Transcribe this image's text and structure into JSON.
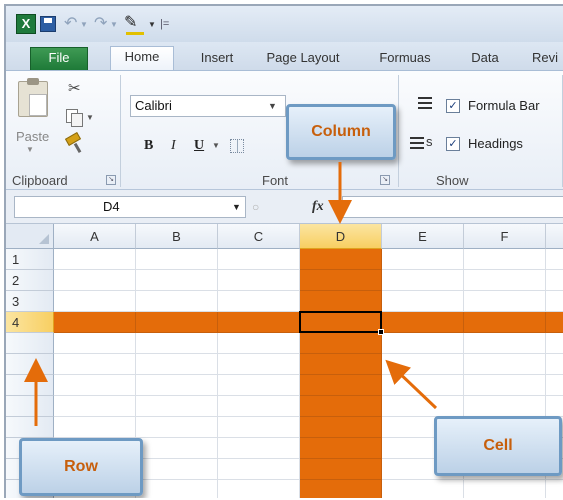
{
  "quick_access": {
    "logo_text": "X",
    "more_glyph": "|="
  },
  "tabs": {
    "file": "File",
    "home": "Home",
    "insert": "Insert",
    "page_layout": "Page Layout",
    "formulas": "Formuas",
    "data": "Data",
    "review": "Revi"
  },
  "ribbon": {
    "clipboard": {
      "paste_label": "Paste",
      "group_label": "Clipboard"
    },
    "font": {
      "font_name": "Calibri",
      "bold": "B",
      "italic": "I",
      "underline": "U",
      "group_label": "Font"
    },
    "show": {
      "gridlines_tail": "s",
      "formula_bar_label": "Formula Bar",
      "headings_label": "Headings",
      "formula_bar_checked": true,
      "headings_checked": true,
      "group_label": "Show"
    }
  },
  "formula_bar": {
    "name_box": "D4",
    "fx": "fx",
    "formula": ""
  },
  "sheet": {
    "columns": [
      "A",
      "B",
      "C",
      "D",
      "E",
      "F"
    ],
    "rows": [
      "1",
      "2",
      "3",
      "4"
    ],
    "selected_column": "D",
    "selected_row": "4",
    "active_cell": "D4",
    "highlight_color": "#e46c0a",
    "selected_header_color": "#f8cf62"
  },
  "callouts": {
    "column": "Column",
    "cell": "Cell",
    "row": "Row",
    "text_color": "#c75f0c"
  }
}
